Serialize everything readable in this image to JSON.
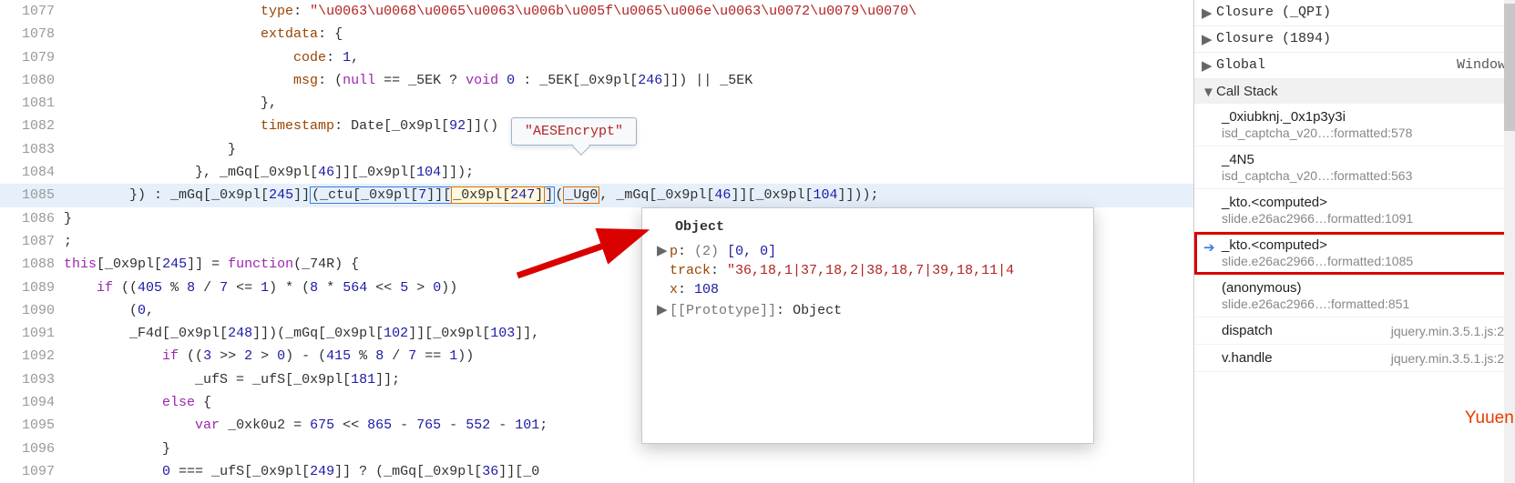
{
  "code": {
    "lines": [
      {
        "n": "1077"
      },
      {
        "n": "1078"
      },
      {
        "n": "1079"
      },
      {
        "n": "1080"
      },
      {
        "n": "1081"
      },
      {
        "n": "1082"
      },
      {
        "n": "1083"
      },
      {
        "n": "1084"
      },
      {
        "n": "1085",
        "hl": true
      },
      {
        "n": "1086"
      },
      {
        "n": "1087"
      },
      {
        "n": "1088"
      },
      {
        "n": "1089"
      },
      {
        "n": "1090"
      },
      {
        "n": "1091"
      },
      {
        "n": "1092"
      },
      {
        "n": "1093"
      },
      {
        "n": "1094"
      },
      {
        "n": "1095"
      },
      {
        "n": "1096"
      },
      {
        "n": "1097"
      }
    ],
    "l1077_prop": "type",
    "l1077_str": "\"\\u0063\\u0068\\u0065\\u0063\\u006b\\u005f\\u0065\\u006e\\u0063\\u0072\\u0079\\u0070\\",
    "l1078_prop": "extdata",
    "l1079_prop": "code",
    "l1079_val": "1",
    "l1080_prop": "msg",
    "l1080_kw_null": "null",
    "l1080_ident1": "_5EK",
    "l1080_kw_void": "void",
    "l1080_num0": "0",
    "l1080_ident2": "_5EK",
    "l1080_arr": "_0x9pl",
    "l1080_idx": "246",
    "l1080_ident3": "_5EK",
    "l1082_prop": "timestamp",
    "l1082_date": "Date",
    "l1082_arr": "_0x9pl",
    "l1082_idx": "92",
    "l1084_ident": "_mGq",
    "l1084_arr1": "_0x9pl",
    "l1084_idx1": "46",
    "l1084_arr2": "_0x9pl",
    "l1084_idx2": "104",
    "l1085_ident1": "_mGq",
    "l1085_arr1": "_0x9pl",
    "l1085_idx1": "245",
    "l1085_ident2": "_ctu",
    "l1085_arr2": "_0x9pl",
    "l1085_idx2": "7",
    "l1085_arr3": "_0x9pl",
    "l1085_idx3": "247",
    "l1085_ident3": "_Ug0",
    "l1085_ident4": "_mGq",
    "l1085_arr4": "_0x9pl",
    "l1085_idx4": "46",
    "l1085_arr5": "_0x9pl",
    "l1085_idx5": "104",
    "l1088_this": "this",
    "l1088_arr": "_0x9pl",
    "l1088_idx": "245",
    "l1088_kw": "function",
    "l1088_param": "_74R",
    "l1089_kw": "if",
    "l1089_a": "405",
    "l1089_b": "8",
    "l1089_c": "7",
    "l1089_d": "1",
    "l1089_e": "8",
    "l1089_f": "564",
    "l1089_g": "5",
    "l1089_h": "0",
    "l1090_num": "0",
    "l1091_ident": "_F4d",
    "l1091_arr1": "_0x9pl",
    "l1091_idx1": "248",
    "l1091_ident2": "_mGq",
    "l1091_arr2": "_0x9pl",
    "l1091_idx2": "102",
    "l1091_arr3": "_0x9pl",
    "l1091_idx3": "103",
    "l1092_kw": "if",
    "l1092_a": "3",
    "l1092_b": "2",
    "l1092_c": "0",
    "l1092_d": "415",
    "l1092_e": "8",
    "l1092_f": "7",
    "l1092_g": "1",
    "l1093_ident1": "_ufS",
    "l1093_ident2": "_ufS",
    "l1093_arr": "_0x9pl",
    "l1093_idx": "181",
    "l1094_kw": "else",
    "l1095_kw": "var",
    "l1095_ident": "_0xk0u2",
    "l1095_a": "675",
    "l1095_b": "865",
    "l1095_c": "765",
    "l1095_d": "552",
    "l1095_e": "101",
    "l1097_a": "0",
    "l1097_ident1": "_ufS",
    "l1097_arr1": "_0x9pl",
    "l1097_idx1": "249",
    "l1097_ident2": "_mGq",
    "l1097_arr2": "_0x9pl",
    "l1097_idx2": "36",
    "l1097_arr3": "_0"
  },
  "tooltip": {
    "text": "\"AESEncrypt\""
  },
  "object": {
    "title": "Object",
    "p_key": "p",
    "p_len": "(2)",
    "p_val": "[0, 0]",
    "track_key": "track",
    "track_val": "\"36,18,1|37,18,2|38,18,7|39,18,11|4",
    "x_key": "x",
    "x_val": "108",
    "proto_key": "[[Prototype]]",
    "proto_val": "Object"
  },
  "scope": {
    "a": {
      "label": "Closure",
      "arg": "(_QPI)"
    },
    "b": {
      "label": "Closure",
      "arg": "(1894)"
    },
    "c": {
      "label": "Global",
      "val": "Window"
    }
  },
  "callstack": {
    "header": "Call Stack",
    "items": [
      {
        "name": "_0xiubknj._0x1p3y3i",
        "loc": "isd_captcha_v20…:formatted:578"
      },
      {
        "name": "_4N5",
        "loc": "isd_captcha_v20…:formatted:563"
      },
      {
        "name": "_kto.<computed>",
        "loc": "slide.e26ac2966…formatted:1091"
      },
      {
        "name": "_kto.<computed>",
        "loc": "slide.e26ac2966…formatted:1085",
        "current": true,
        "hl": true
      },
      {
        "name": "(anonymous)",
        "loc": "slide.e26ac2966…:formatted:851"
      },
      {
        "name": "dispatch",
        "loc": "jquery.min.3.5.1.js:2",
        "inline": true
      },
      {
        "name": "v.handle",
        "loc": "jquery.min.3.5.1.js:2",
        "inline": true
      }
    ]
  },
  "watermark": "Yuuen.com"
}
